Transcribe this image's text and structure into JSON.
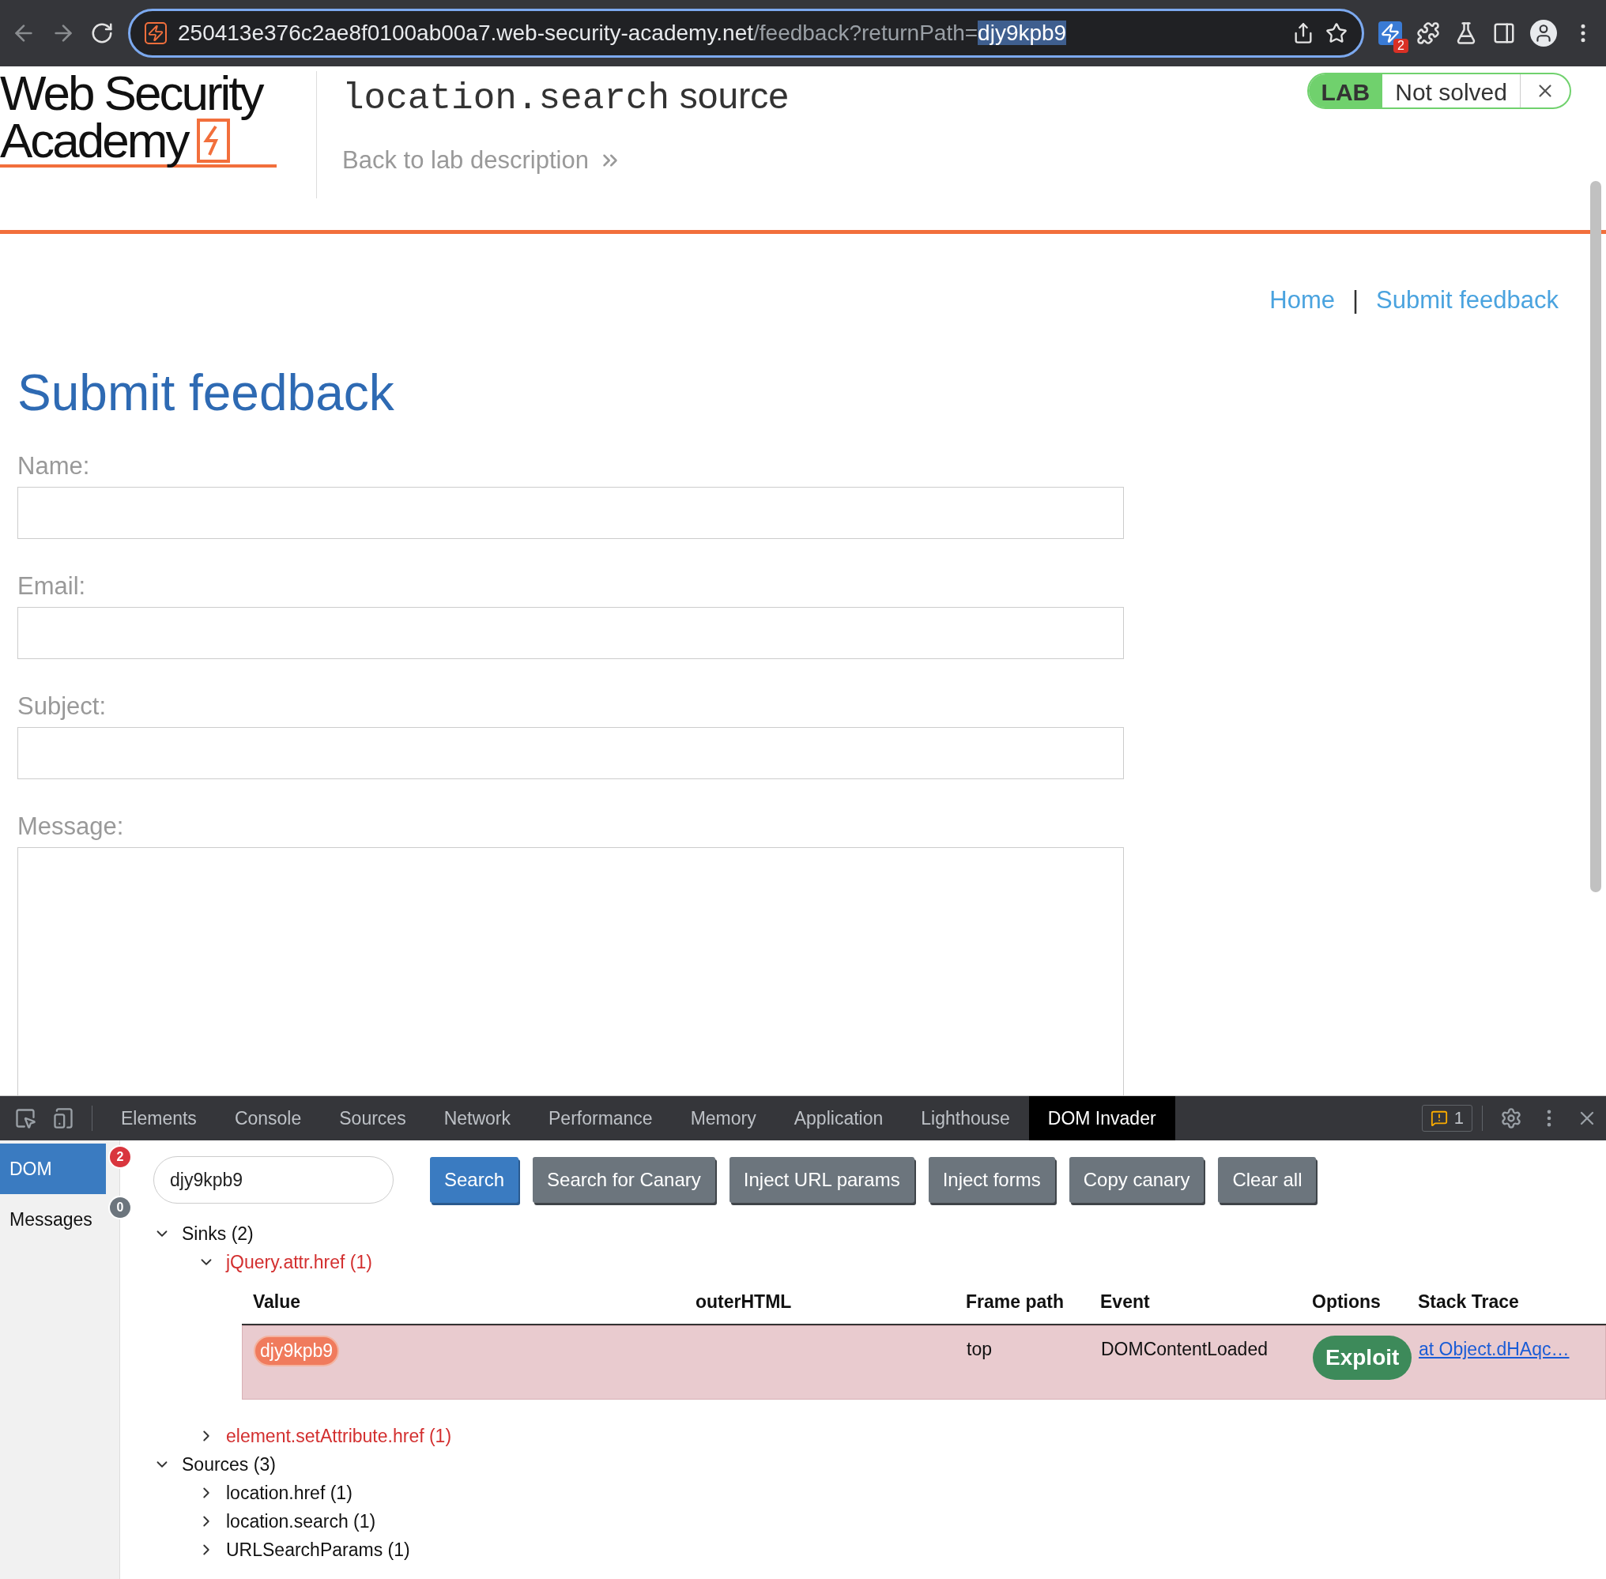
{
  "browser": {
    "url": {
      "host": "250413e376c2ae8f0100ab00a7.web-security-academy.net",
      "path": "/feedback?returnPath=",
      "selected_text": "djy9kpb9"
    },
    "extension_badge": "2"
  },
  "lab_header": {
    "logo": [
      "Web Security",
      "Academy"
    ],
    "title_code": "location.search",
    "title_rest": "source",
    "back_link": "Back to lab description",
    "status_label": "LAB",
    "status": "Not solved"
  },
  "nav": {
    "links": [
      {
        "label": "Home"
      },
      {
        "label": "Submit feedback"
      }
    ],
    "separator": "|"
  },
  "form": {
    "heading": "Submit feedback",
    "fields": [
      {
        "label": "Name:",
        "kind": "input"
      },
      {
        "label": "Email:",
        "kind": "input"
      },
      {
        "label": "Subject:",
        "kind": "input"
      },
      {
        "label": "Message:",
        "kind": "textarea"
      }
    ]
  },
  "devtools": {
    "tabs": [
      {
        "label": "Elements",
        "selected": false
      },
      {
        "label": "Console",
        "selected": false
      },
      {
        "label": "Sources",
        "selected": false
      },
      {
        "label": "Network",
        "selected": false
      },
      {
        "label": "Performance",
        "selected": false
      },
      {
        "label": "Memory",
        "selected": false
      },
      {
        "label": "Application",
        "selected": false
      },
      {
        "label": "Lighthouse",
        "selected": false
      },
      {
        "label": "DOM Invader",
        "selected": true
      }
    ],
    "issues_count": "1",
    "sidebar": [
      {
        "label": "DOM",
        "count": "2",
        "selected": true
      },
      {
        "label": "Messages",
        "count": "0",
        "selected": false
      }
    ],
    "search": {
      "value": "djy9kpb9"
    },
    "buttons": [
      {
        "label": "Search",
        "kind": "primary"
      },
      {
        "label": "Search for Canary",
        "kind": "secondary"
      },
      {
        "label": "Inject URL params",
        "kind": "secondary"
      },
      {
        "label": "Inject forms",
        "kind": "secondary"
      },
      {
        "label": "Copy canary",
        "kind": "secondary"
      },
      {
        "label": "Clear all",
        "kind": "secondary"
      }
    ],
    "tree": [
      {
        "label": "Sinks (2)",
        "expanded": true,
        "children": [
          {
            "label": "jQuery.attr.href (1)",
            "kind": "sink",
            "expanded": true,
            "table": {
              "columns": [
                "Value",
                "outerHTML",
                "Frame path",
                "Event",
                "Options",
                "Stack Trace"
              ],
              "rows": [
                {
                  "value": "djy9kpb9",
                  "frame_path": "top",
                  "event": "DOMContentLoaded",
                  "option": "Exploit",
                  "stack_trace": "at Object.dHAqc…"
                }
              ]
            }
          },
          {
            "label": "element.setAttribute.href (1)",
            "kind": "sink",
            "expanded": false
          }
        ]
      },
      {
        "label": "Sources (3)",
        "expanded": true,
        "children": [
          {
            "label": "location.href (1)",
            "kind": "entry",
            "expanded": false
          },
          {
            "label": "location.search (1)",
            "kind": "entry",
            "expanded": false
          },
          {
            "label": "URLSearchParams (1)",
            "kind": "entry",
            "expanded": false
          }
        ]
      }
    ]
  }
}
